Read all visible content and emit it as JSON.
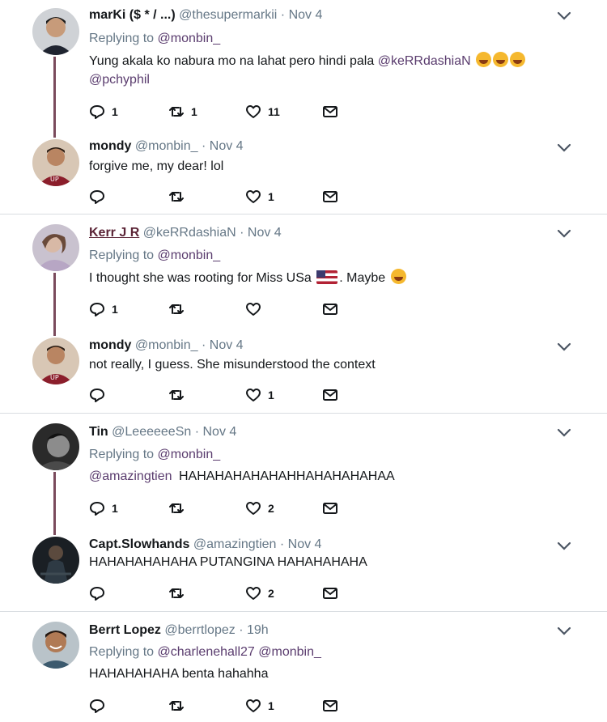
{
  "tweets": [
    {
      "name": "marKi ($ * / ...)",
      "handle": "@thesupermarkii",
      "time": "Nov 4",
      "replying_label": "Replying to",
      "replying_to": "@monbin_",
      "text": "Yung akala ko nabura mo na lahat pero hindi pala",
      "text_mention": "@keRRdashiaN",
      "text_line2": "@pchyphil",
      "reply_count": "1",
      "retweet_count": "1",
      "like_count": "11",
      "avatar": "avatar-dark-shirt"
    },
    {
      "name": "mondy",
      "handle": "@monbin_",
      "time": "Nov 4",
      "text": "forgive me, my dear! lol",
      "reply_count": "",
      "retweet_count": "",
      "like_count": "1",
      "avatar": "avatar-red-shirt"
    },
    {
      "name": "Kerr J R",
      "handle": "@keRRdashiaN",
      "time": "Nov 4",
      "replying_label": "Replying to",
      "replying_to": "@monbin_",
      "text": "I thought she was rooting for Miss USa",
      "text_after": ". Maybe",
      "reply_count": "1",
      "retweet_count": "",
      "like_count": "",
      "avatar": "avatar-purple"
    },
    {
      "name": "mondy",
      "handle": "@monbin_",
      "time": "Nov 4",
      "text": "not really, I guess. She misunderstood the context",
      "reply_count": "",
      "retweet_count": "",
      "like_count": "1",
      "avatar": "avatar-red-shirt"
    },
    {
      "name": "Tin",
      "handle": "@LeeeeeeSn",
      "time": "Nov 4",
      "replying_label": "Replying to",
      "replying_to": "@monbin_",
      "text_mention": "@amazingtien",
      "text": "HAHAHAHAHAHAHHAHAHAHAHAA",
      "reply_count": "1",
      "retweet_count": "",
      "like_count": "2",
      "avatar": "avatar-bw"
    },
    {
      "name": "Capt.Slowhands",
      "handle": "@amazingtien",
      "time": "Nov 4",
      "text": "HAHAHAHAHAHA PUTANGINA HAHAHAHAHA",
      "reply_count": "",
      "retweet_count": "",
      "like_count": "2",
      "avatar": "avatar-dark-night"
    },
    {
      "name": "Berrt Lopez",
      "handle": "@berrtlopez",
      "time": "19h",
      "replying_label": "Replying to",
      "replying_to": "@charlenehall27",
      "replying_to_2": "@monbin_",
      "text": "HAHAHAHAHA benta hahahha",
      "reply_count": "",
      "retweet_count": "",
      "like_count": "1",
      "avatar": "avatar-smile"
    }
  ],
  "separator": "·",
  "icons": {
    "reply": "reply-icon",
    "retweet": "retweet-icon",
    "like": "heart-icon",
    "dm": "envelope-icon",
    "more": "chevron-down-icon"
  },
  "colors": {
    "thread_line": "#7a4b5c",
    "mention": "#5a3c6e",
    "muted": "#657786",
    "divider": "#d9dde1"
  }
}
